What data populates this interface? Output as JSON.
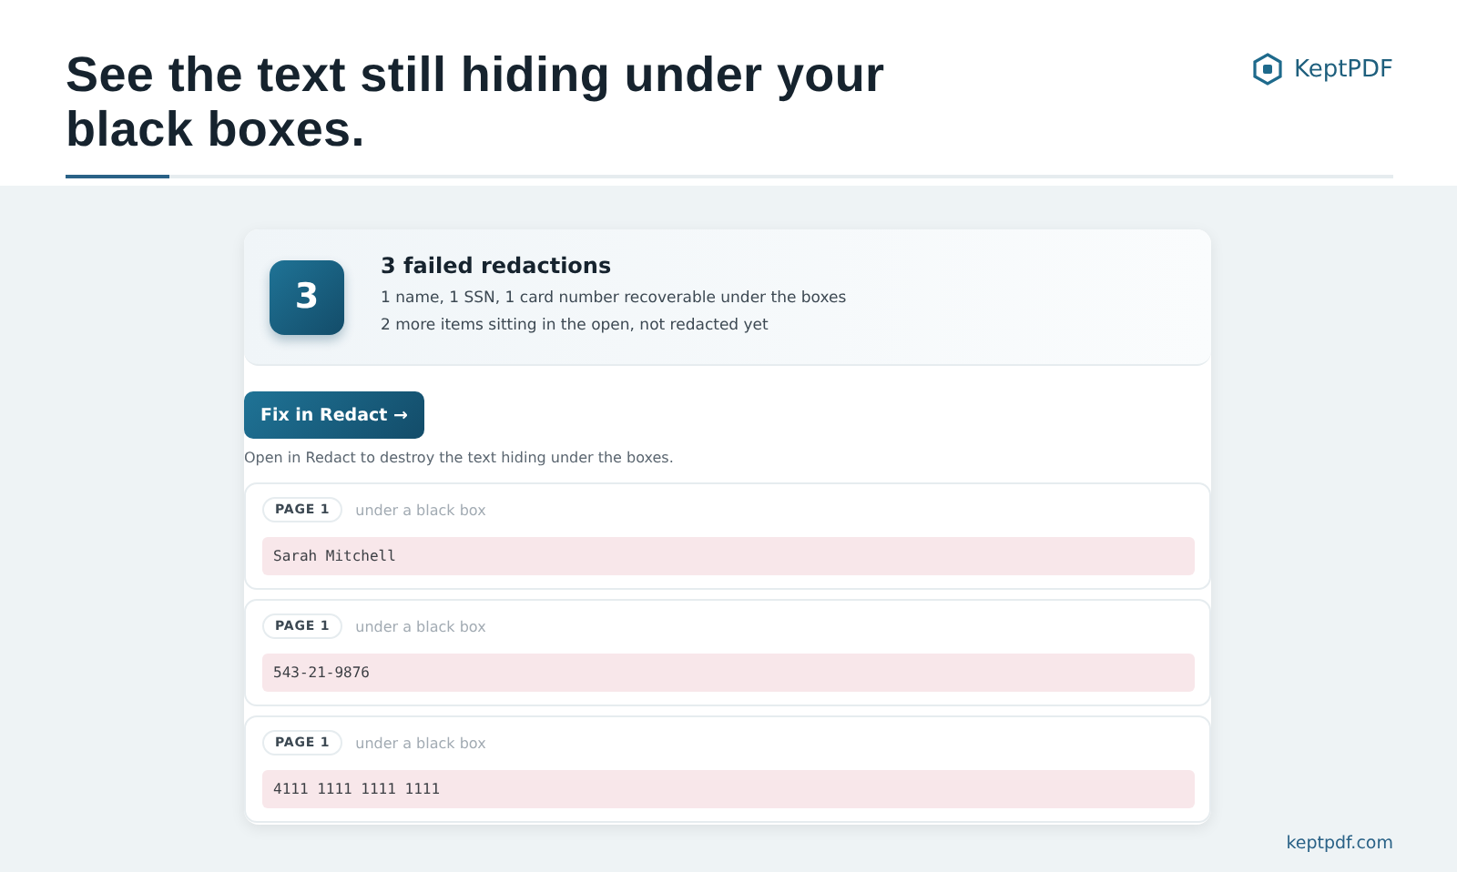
{
  "header": {
    "title": "See the text still hiding under your black boxes.",
    "brand": "KeptPDF"
  },
  "summary": {
    "count": "3",
    "title": "3 failed redactions",
    "lines": [
      "1 name, 1 SSN, 1 card number recoverable under the boxes",
      "2 more items sitting in the open, not redacted yet"
    ]
  },
  "action": {
    "button": "Fix in Redact →",
    "note": "Open in Redact to destroy the text hiding under the boxes."
  },
  "findings": [
    {
      "page": "PAGE 1",
      "where": "under a black box",
      "text": "Sarah Mitchell"
    },
    {
      "page": "PAGE 1",
      "where": "under a black box",
      "text": "543-21-9876"
    },
    {
      "page": "PAGE 1",
      "where": "under a black box",
      "text": "4111 1111 1111 1111"
    }
  ],
  "footer": {
    "site": "keptpdf.com"
  }
}
